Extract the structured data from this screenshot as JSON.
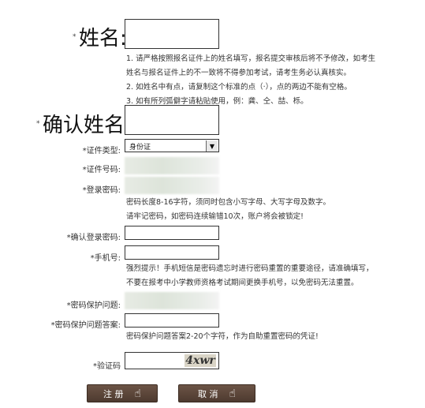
{
  "fields": {
    "name_label": "姓名:",
    "name_star": "*",
    "name_notes": [
      "1. 请严格按照报名证件上的姓名填写，报名提交审核后将不予修改，如考生",
      "姓名与报名证件上的不一致将不得参加考试，请考生务必认真核实。",
      "2. 如姓名中有点，请复制这个标准的点（·），点的两边不能有空格。",
      "3. 如有所列弧僻字请粘贴使用，例：龚、仝、喆、栎。"
    ],
    "confirm_name_label": "确认姓名:",
    "confirm_name_star": "*",
    "id_type_label": "*证件类型:",
    "id_type_value": "身份证",
    "id_number_label": "*证件号码:",
    "login_password_label": "*登录密码:",
    "password_notes": [
      "密码长度8-16字符，须同时包含小写字母、大写字母及数字。",
      "请牢记密码，如密码连续输错10次，账户将会被锁定!"
    ],
    "confirm_password_label": "*确认登录密码:",
    "phone_label": "*手机号:",
    "phone_notes": [
      "强烈提示！手机短信是密码遗忘时进行密码重置的重要途径，请准确填写，",
      "不要在报考中小学教师资格考试期间更换手机号，以免密码无法重置。"
    ],
    "security_question_label": "*密码保护问题:",
    "security_answer_label": "*密码保护问题答案:",
    "answer_notes": [
      "密码保护问题答案2-20个字符，作为自助重置密码的凭证!"
    ],
    "captcha_label": "*验证码",
    "captcha_text": "4xwr"
  },
  "buttons": {
    "register": "注 册",
    "cancel": "取 消"
  }
}
